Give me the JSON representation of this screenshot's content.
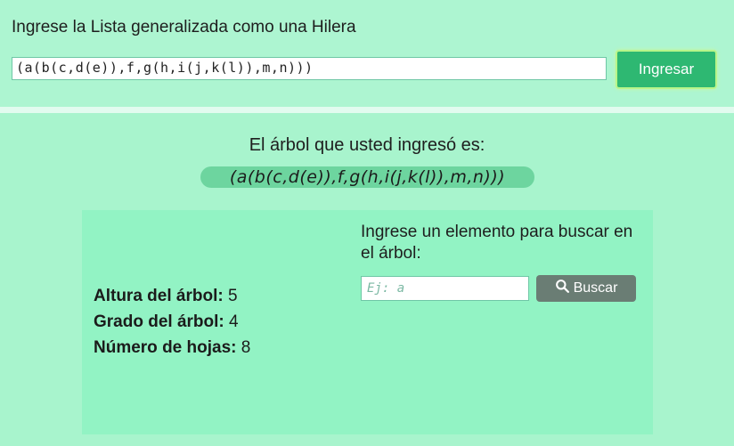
{
  "header": {
    "prompt": "Ingrese la Lista generalizada como una Hilera",
    "list_value": "(a(b(c,d(e)),f,g(h,i(j,k(l)),m,n)))",
    "submit_label": "Ingresar"
  },
  "result": {
    "label": "El árbol que usted ingresó es:",
    "tree": "(a(b(c,d(e)),f,g(h,i(j,k(l)),m,n)))"
  },
  "stats": {
    "altura_label": "Altura del árbol:",
    "altura_value": "5",
    "grado_label": "Grado del árbol:",
    "grado_value": "4",
    "hojas_label": "Número de hojas:",
    "hojas_value": "8"
  },
  "search": {
    "prompt": "Ingrese un elemento para buscar en el árbol:",
    "placeholder": "Ej: a",
    "button_label": "Buscar",
    "button_icon": "search-icon"
  },
  "colors": {
    "background": "#adf5d1",
    "panel": "#92f3c4",
    "primary_button": "#2eb872",
    "secondary_button": "#6a7d74",
    "tree_pill": "#6dd59f"
  }
}
